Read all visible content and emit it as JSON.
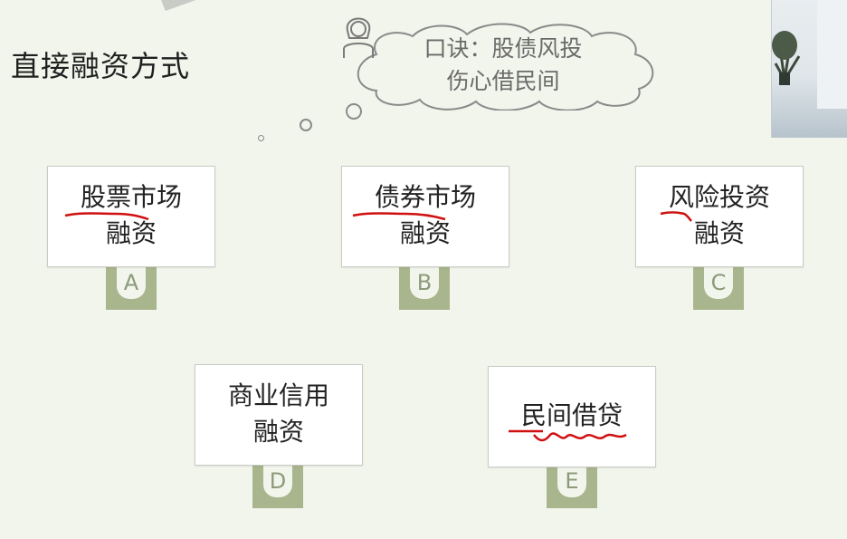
{
  "title": "直接融资方式",
  "thought": {
    "line1": "口诀：股债风投",
    "line2": "伤心借民间"
  },
  "cards": [
    {
      "id": "a",
      "line1": "股票市场",
      "line2": "融资",
      "letter": "A"
    },
    {
      "id": "b",
      "line1": "债券市场",
      "line2": "融资",
      "letter": "B"
    },
    {
      "id": "c",
      "line1": "风险投资",
      "line2": "融资",
      "letter": "C"
    },
    {
      "id": "d",
      "line1": "商业信用",
      "line2": "融资",
      "letter": "D"
    },
    {
      "id": "e",
      "line1": "民间借贷",
      "line2": "",
      "letter": "E"
    }
  ],
  "colors": {
    "background": "#f2f5ec",
    "tab": "#a9b58d",
    "annotation": "#d01010"
  }
}
